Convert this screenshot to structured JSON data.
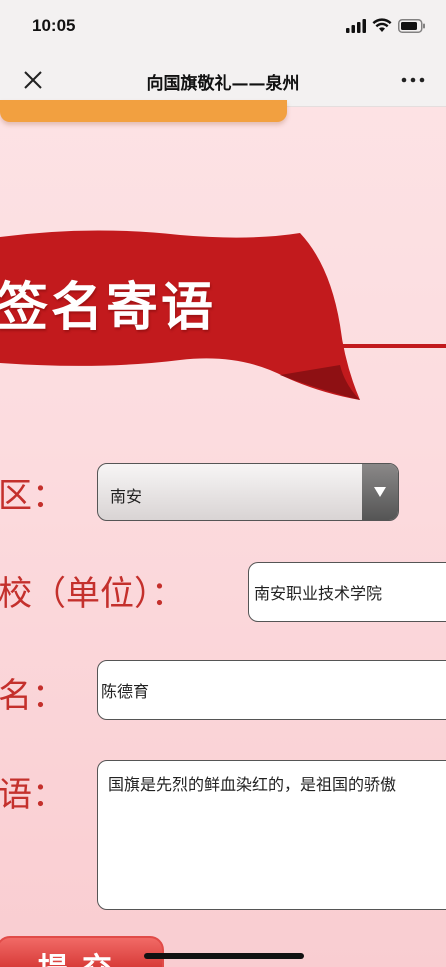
{
  "status_bar": {
    "time": "10:05"
  },
  "nav": {
    "title": "向国旗敬礼——泉州"
  },
  "banner": {
    "title": "签名寄语"
  },
  "form": {
    "region_label": "区：",
    "region_value": "南安",
    "school_label": "校（单位）：",
    "school_value": "南安职业技术学院",
    "name_label": "名：",
    "name_value": "陈德育",
    "message_label": "语：",
    "message_value": "国旗是先烈的鲜血染红的，是祖国的骄傲",
    "submit_label": "提交"
  },
  "colors": {
    "banner_red": "#c21a1d",
    "label_red": "#c4302c",
    "accent_orange": "#f2a040",
    "background_pink": "#fcdcdf"
  }
}
